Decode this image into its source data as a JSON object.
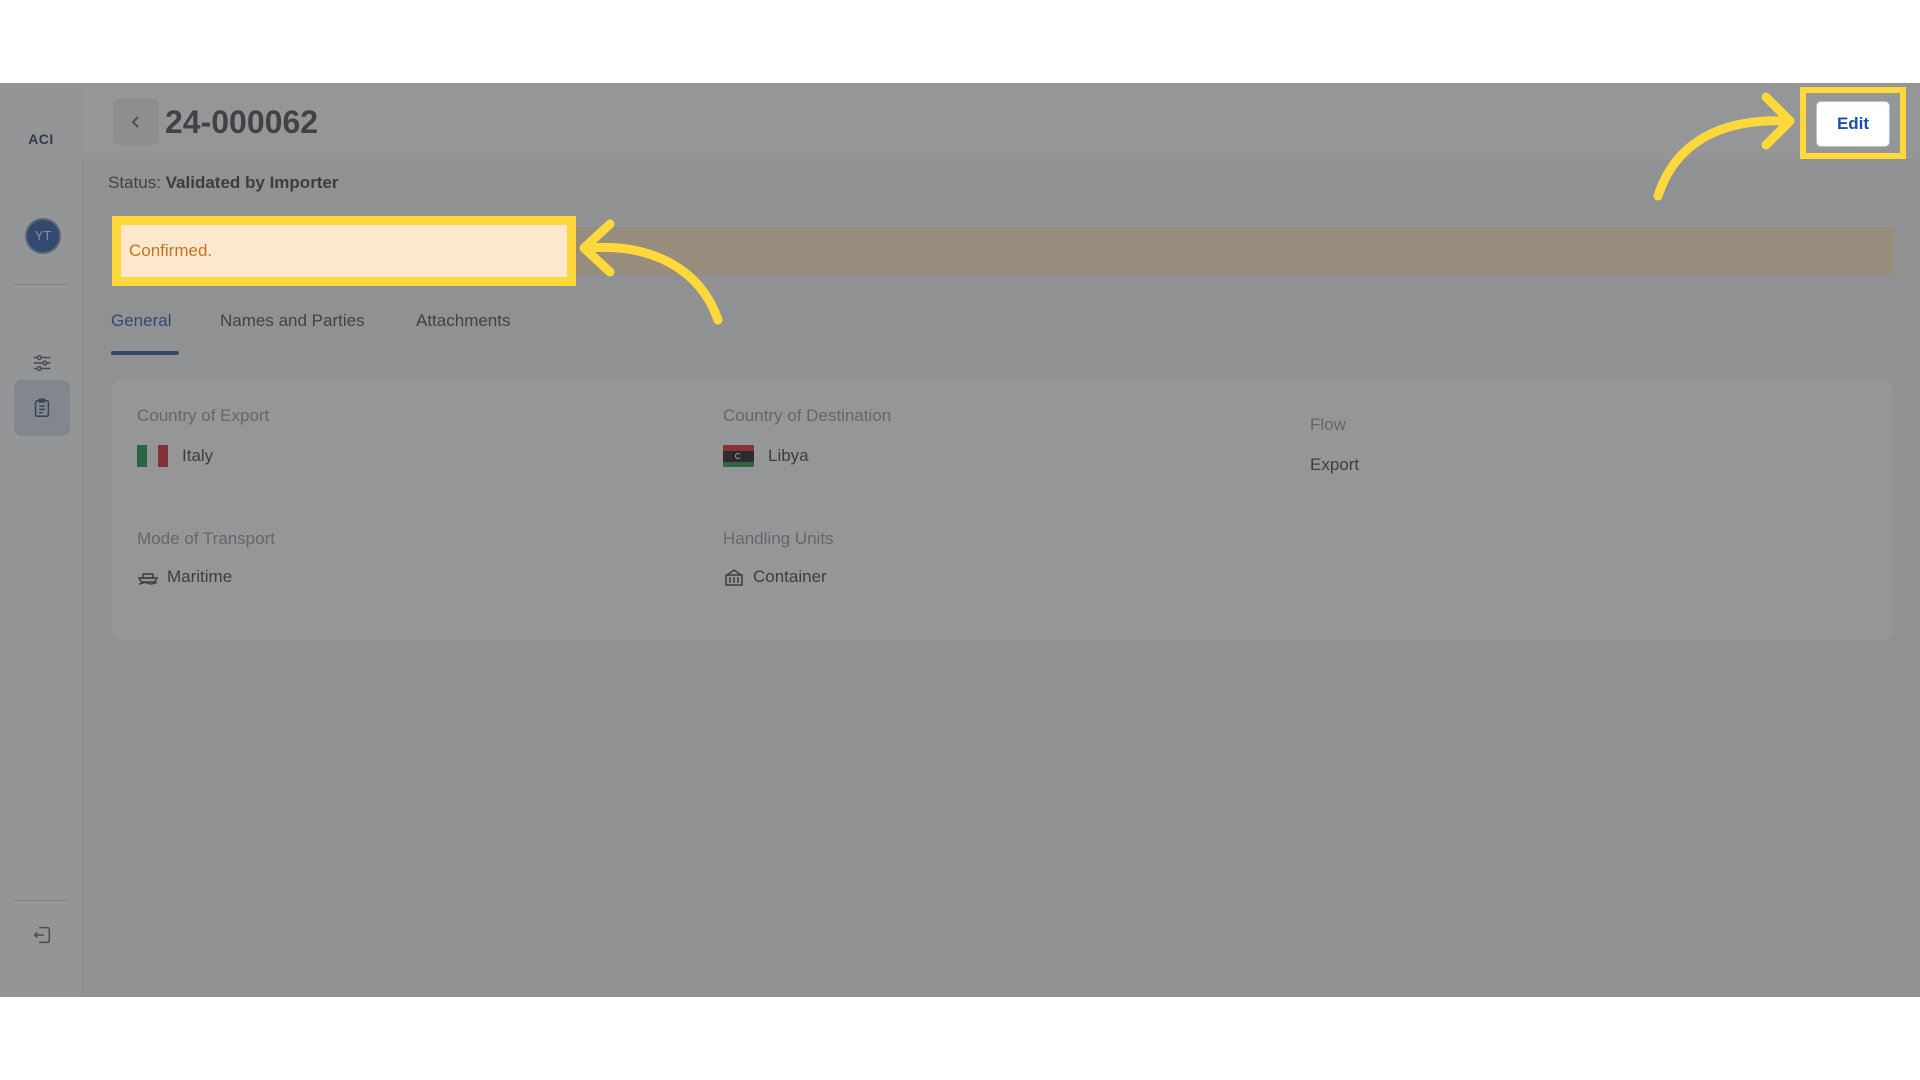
{
  "sidebar": {
    "logo": "ACI",
    "avatar_initials": "YT",
    "items": [
      {
        "name": "settings-sliders-icon",
        "active": false
      },
      {
        "name": "clipboard-icon",
        "active": true
      }
    ],
    "logout_icon": "logout-icon"
  },
  "header": {
    "title": "24-000062",
    "back_icon": "chevron-left-icon",
    "edit_label": "Edit"
  },
  "status": {
    "label": "Status:",
    "value": "Validated by Importer"
  },
  "alert": {
    "message": "Confirmed."
  },
  "tabs": [
    {
      "label": "General",
      "active": true
    },
    {
      "label": "Names and Parties",
      "active": false
    },
    {
      "label": "Attachments",
      "active": false
    }
  ],
  "general": {
    "country_of_export": {
      "label": "Country of Export",
      "value": "Italy",
      "flag": "italy-flag"
    },
    "country_of_destination": {
      "label": "Country of Destination",
      "value": "Libya",
      "flag": "libya-flag"
    },
    "flow": {
      "label": "Flow",
      "value": "Export"
    },
    "mode_of_transport": {
      "label": "Mode of Transport",
      "value": "Maritime",
      "icon": "ship-icon"
    },
    "handling_units": {
      "label": "Handling Units",
      "value": "Container",
      "icon": "container-icon"
    }
  },
  "colors": {
    "accent": "#1f4fa8",
    "highlight": "#ffd93b",
    "alert_text": "#c57520",
    "alert_bg": "#fde4c2"
  }
}
